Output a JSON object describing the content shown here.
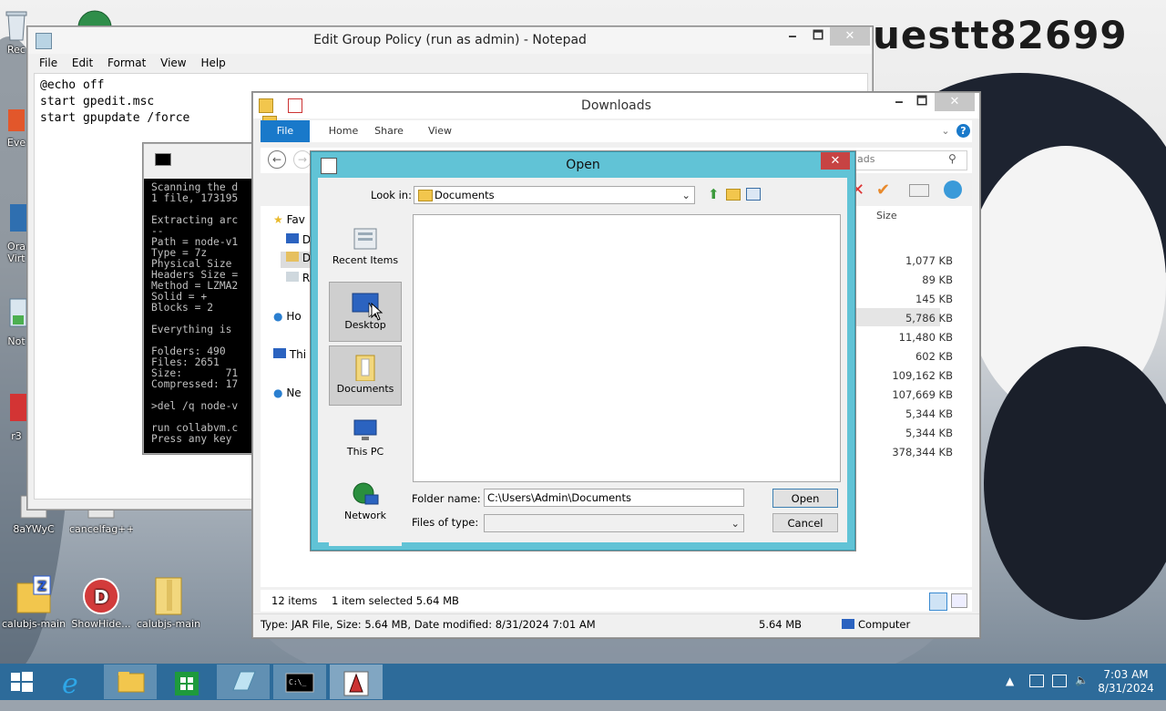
{
  "wallpaper_text": "uestt82699",
  "desktop_icons": [
    {
      "label": "Rec"
    },
    {
      "label": "Eve"
    },
    {
      "label": "Ora"
    },
    {
      "label": "Virt"
    },
    {
      "label": "Not"
    },
    {
      "label": "r3"
    },
    {
      "label": "8aYWyC"
    },
    {
      "label": "cancelfag++"
    },
    {
      "label": "calubjs-main"
    },
    {
      "label": "ShowHide..."
    },
    {
      "label": "calubjs-main"
    }
  ],
  "notepad": {
    "title": "Edit Group Policy (run as admin) - Notepad",
    "menu": [
      "File",
      "Edit",
      "Format",
      "View",
      "Help"
    ],
    "content": "@echo off\nstart gpedit.msc\nstart gpupdate /force",
    "minimize": "🗕",
    "maximize": "🗖",
    "close": "✕"
  },
  "console": {
    "text": "Scanning the d\n1 file, 173195\n\nExtracting arc\n--\nPath = node-v1\nType = 7z\nPhysical Size \nHeaders Size =\nMethod = LZMA2\nSolid = +\nBlocks = 2\n\nEverything is \n\nFolders: 490\nFiles: 2651\nSize:       71\nCompressed: 17\n\n>del /q node-v\n\nrun collabvm.c\nPress any key "
  },
  "explorer": {
    "title": "Downloads",
    "ribbon_tabs": [
      "File",
      "Home",
      "Share",
      "View"
    ],
    "search_placeholder": "ads",
    "nav_items": [
      "Fav",
      "D",
      "D",
      "R",
      "Ho",
      "Thi",
      "Ne"
    ],
    "column_size": "Size",
    "sizes": [
      "1,077 KB",
      "89 KB",
      "145 KB",
      "5,786 KB",
      "11,480 KB",
      "602 KB",
      "109,162 KB",
      "107,669 KB",
      "5,344 KB",
      "5,344 KB",
      "378,344 KB"
    ],
    "status_items": "12 items",
    "status_selected": "1 item selected  5.64 MB",
    "details_type": "Type: JAR File, Size: 5.64 MB, Date modified: 8/31/2024 7:01 AM",
    "details_size": "5.64 MB",
    "details_location": "Computer",
    "minimize": "🗕",
    "maximize": "🗖",
    "close": "✕"
  },
  "open_dialog": {
    "title": "Open",
    "close": "✕",
    "look_in_label": "Look in:",
    "look_in_value": "Documents",
    "places": [
      {
        "label": "Recent Items"
      },
      {
        "label": "Desktop"
      },
      {
        "label": "Documents"
      },
      {
        "label": "This PC"
      },
      {
        "label": "Network"
      }
    ],
    "folder_name_label": "Folder name:",
    "folder_name_value": "C:\\Users\\Admin\\Documents",
    "files_of_type_label": "Files of type:",
    "files_of_type_value": "",
    "open_button": "Open",
    "cancel_button": "Cancel"
  },
  "taskbar": {
    "time": "7:03 AM",
    "date": "8/31/2024"
  },
  "colors": {
    "taskbar": "#2d6b9a",
    "dialog_frame": "#61c3d6",
    "ribbon_file": "#1979ca",
    "close_red": "#c74343"
  }
}
